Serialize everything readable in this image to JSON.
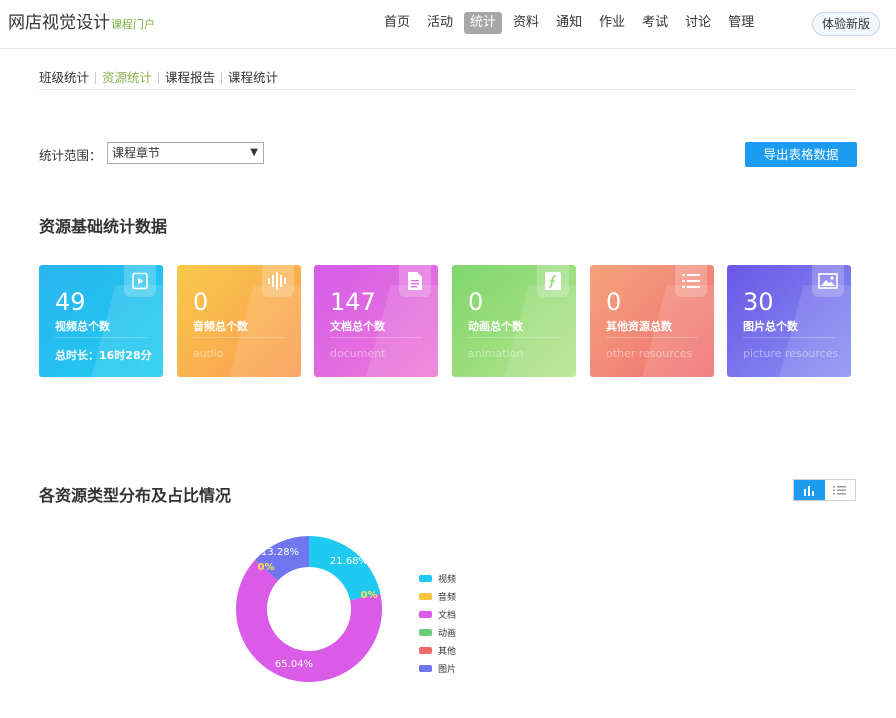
{
  "brand": {
    "title": "网店视觉设计",
    "subtitle": "课程门户"
  },
  "nav": {
    "items": [
      {
        "label": "首页",
        "active": false
      },
      {
        "label": "活动",
        "active": false
      },
      {
        "label": "统计",
        "active": true
      },
      {
        "label": "资料",
        "active": false
      },
      {
        "label": "通知",
        "active": false
      },
      {
        "label": "作业",
        "active": false
      },
      {
        "label": "考试",
        "active": false
      },
      {
        "label": "讨论",
        "active": false
      },
      {
        "label": "管理",
        "active": false
      }
    ],
    "try_new": "体验新版"
  },
  "subtabs": [
    {
      "label": "班级统计",
      "active": false
    },
    {
      "label": "资源统计",
      "active": true
    },
    {
      "label": "课程报告",
      "active": false
    },
    {
      "label": "课程统计",
      "active": false
    }
  ],
  "filter": {
    "label": "统计范围：",
    "selected": "课程章节",
    "export_label": "导出表格数据"
  },
  "section1_title": "资源基础统计数据",
  "section2_title": "各资源类型分布及占比情况",
  "cards": [
    {
      "num": "49",
      "label": "视频总个数",
      "sub": "总时长：16时28分",
      "icon": "video-icon",
      "from": "#2ab4ef",
      "to": "#1fcdf0"
    },
    {
      "num": "0",
      "label": "音频总个数",
      "sub": "audio",
      "icon": "audio-icon",
      "from": "#f8c94a",
      "to": "#fb9b54"
    },
    {
      "num": "147",
      "label": "文档总个数",
      "sub": "document",
      "icon": "document-icon",
      "from": "#d35de9",
      "to": "#f07ad6"
    },
    {
      "num": "0",
      "label": "动画总个数",
      "sub": "animation",
      "icon": "animation-icon",
      "from": "#7fd66e",
      "to": "#b6e48c"
    },
    {
      "num": "0",
      "label": "其他资源总数",
      "sub": "other resources",
      "icon": "list-icon",
      "from": "#f5a37b",
      "to": "#ef6f74"
    },
    {
      "num": "30",
      "label": "图片总个数",
      "sub": "picture resources",
      "icon": "picture-icon",
      "from": "#6a57e6",
      "to": "#8a93f3"
    }
  ],
  "chart_data": {
    "type": "pie",
    "categories": [
      "视频",
      "音频",
      "文档",
      "动画",
      "其他",
      "图片"
    ],
    "values": [
      21.68,
      0,
      65.04,
      0,
      0,
      13.28
    ],
    "data_labels": [
      "21.68%",
      "0%",
      "65.04%",
      "0%",
      "0%",
      "13.28%"
    ],
    "colors": [
      "#1ecaf2",
      "#f9c440",
      "#d95be8",
      "#6ccb7e",
      "#ef6b6b",
      "#6f76f0"
    ],
    "legend_position": "right"
  }
}
